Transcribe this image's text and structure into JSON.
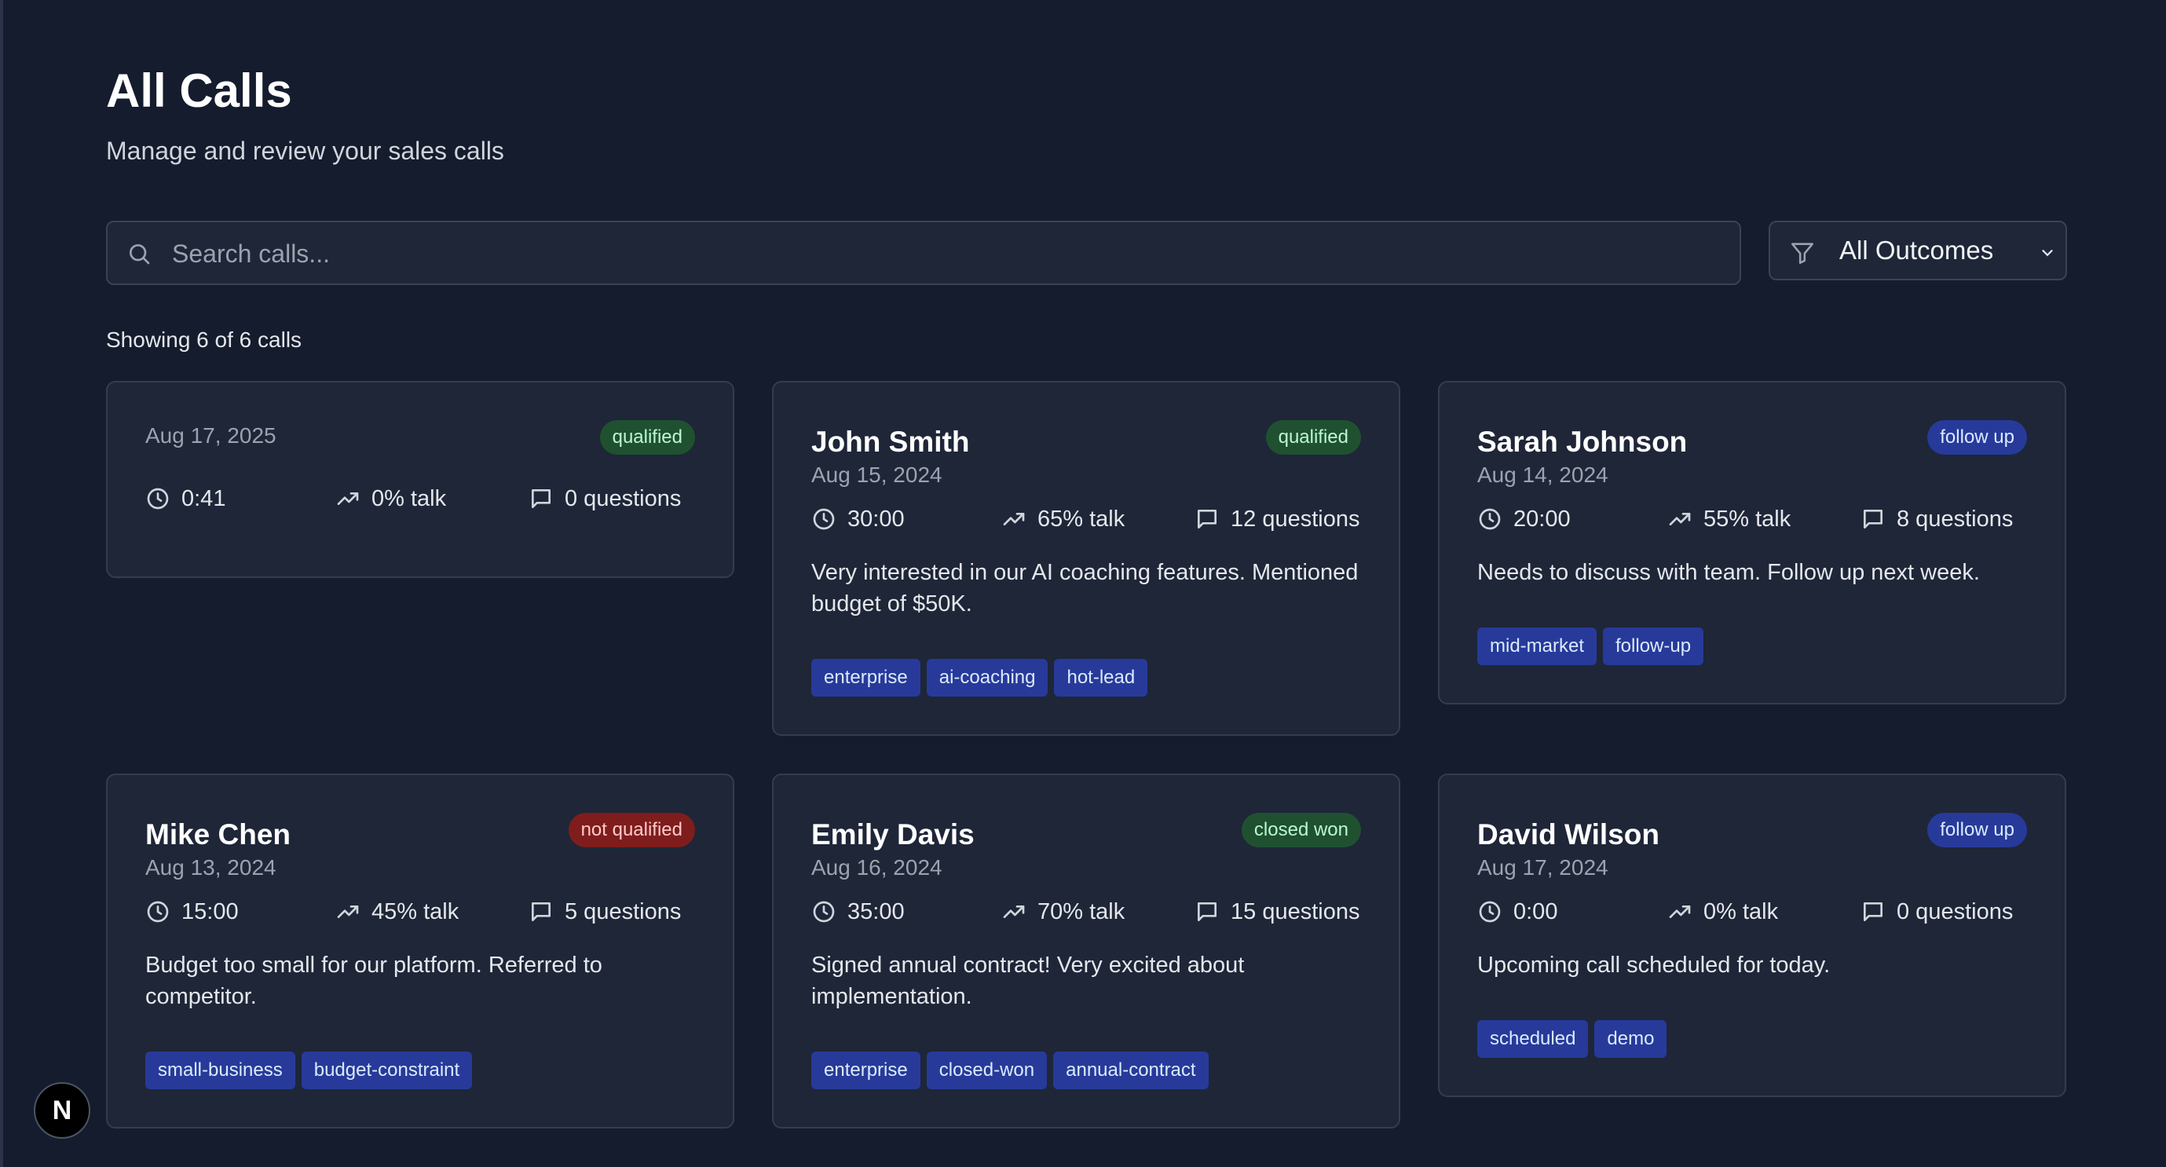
{
  "header": {
    "title": "All Calls",
    "subtitle": "Manage and review your sales calls"
  },
  "search": {
    "placeholder": "Search calls...",
    "value": ""
  },
  "filter": {
    "selected": "All Outcomes"
  },
  "summary": {
    "count_text": "Showing 6 of 6 calls"
  },
  "colors": {
    "background": "#141c2e",
    "card": "#1e2638",
    "badge_green": "#1f5130",
    "badge_blue": "#273a9a",
    "badge_red": "#7f1d1d",
    "tag": "#273a9a"
  },
  "calls": [
    {
      "name": "",
      "date": "Aug 17, 2025",
      "status": "qualified",
      "duration": "0:41",
      "talk": "0% talk",
      "questions": "0 questions",
      "notes": "",
      "tags": []
    },
    {
      "name": "John Smith",
      "date": "Aug 15, 2024",
      "status": "qualified",
      "duration": "30:00",
      "talk": "65% talk",
      "questions": "12 questions",
      "notes": "Very interested in our AI coaching features. Mentioned budget of $50K.",
      "tags": [
        "enterprise",
        "ai-coaching",
        "hot-lead"
      ]
    },
    {
      "name": "Sarah Johnson",
      "date": "Aug 14, 2024",
      "status": "follow up",
      "duration": "20:00",
      "talk": "55% talk",
      "questions": "8 questions",
      "notes": "Needs to discuss with team. Follow up next week.",
      "tags": [
        "mid-market",
        "follow-up"
      ]
    },
    {
      "name": "Mike Chen",
      "date": "Aug 13, 2024",
      "status": "not qualified",
      "duration": "15:00",
      "talk": "45% talk",
      "questions": "5 questions",
      "notes": "Budget too small for our platform. Referred to competitor.",
      "tags": [
        "small-business",
        "budget-constraint"
      ]
    },
    {
      "name": "Emily Davis",
      "date": "Aug 16, 2024",
      "status": "closed won",
      "duration": "35:00",
      "talk": "70% talk",
      "questions": "15 questions",
      "notes": "Signed annual contract! Very excited about implementation.",
      "tags": [
        "enterprise",
        "closed-won",
        "annual-contract"
      ]
    },
    {
      "name": "David Wilson",
      "date": "Aug 17, 2024",
      "status": "follow up",
      "duration": "0:00",
      "talk": "0% talk",
      "questions": "0 questions",
      "notes": "Upcoming call scheduled for today.",
      "tags": [
        "scheduled",
        "demo"
      ]
    }
  ],
  "dev_badge": {
    "letter": "N"
  }
}
